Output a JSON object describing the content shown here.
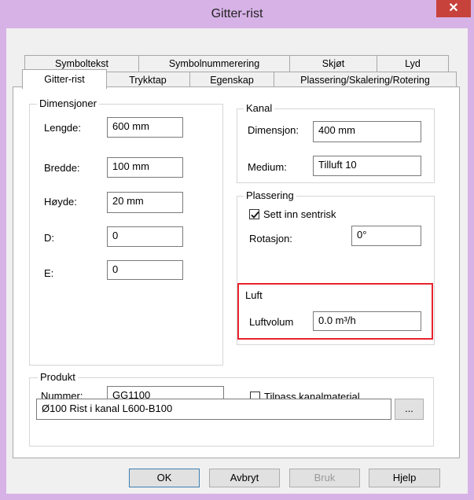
{
  "window": {
    "title": "Gitter-rist",
    "close_symbol": "✕"
  },
  "tabs_row1": [
    "Symboltekst",
    "Symbolnummerering",
    "Skjøt",
    "Lyd"
  ],
  "tabs_row2": [
    "Gitter-rist",
    "Trykktap",
    "Egenskap",
    "Plassering/Skalering/Rotering"
  ],
  "dimensjoner": {
    "title": "Dimensjoner",
    "lengde_label": "Lengde:",
    "lengde": "600 mm",
    "bredde_label": "Bredde:",
    "bredde": "100 mm",
    "hoyde_label": "Høyde:",
    "hoyde": "20 mm",
    "d_label": "D:",
    "d": "0",
    "e_label": "E:",
    "e": "0"
  },
  "kanal": {
    "title": "Kanal",
    "dimensjon_label": "Dimensjon:",
    "dimensjon": "400 mm",
    "medium_label": "Medium:",
    "medium": "Tilluft 10"
  },
  "plassering": {
    "title": "Plassering",
    "sentrisk_label": "Sett inn sentrisk",
    "sentrisk_checked": true,
    "rotasjon_label": "Rotasjon:",
    "rotasjon": "0°"
  },
  "luft": {
    "title": "Luft",
    "luftvolum_label": "Luftvolum",
    "luftvolum": "0.0 m³/h"
  },
  "produkt": {
    "title": "Produkt",
    "nummer_label": "Nummer:",
    "nummer": "GG1100",
    "tilpass_label": "Tilpass kanalmaterial",
    "tilpass_checked": false,
    "beskrivelse": "Ø100 Rist i kanal L600-B100",
    "browse_label": "..."
  },
  "buttons": {
    "ok": "OK",
    "avbryt": "Avbryt",
    "bruk": "Bruk",
    "hjelp": "Hjelp"
  },
  "colors": {
    "frame": "#d7b2e7",
    "close": "#c7423b",
    "highlight": "#e8242d"
  }
}
